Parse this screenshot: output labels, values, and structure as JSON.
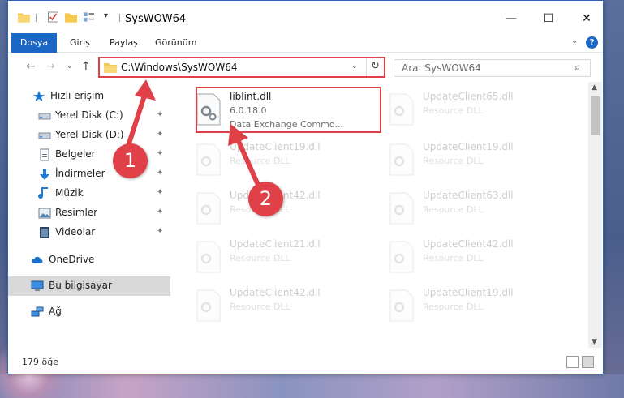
{
  "window": {
    "title": "SysWOW64",
    "min_glyph": "—",
    "max_glyph": "☐",
    "close_glyph": "✕"
  },
  "ribbon": {
    "tabs": [
      "Dosya",
      "Giriş",
      "Paylaş",
      "Görünüm"
    ],
    "help_glyph": "?"
  },
  "navigation": {
    "back_glyph": "←",
    "forward_glyph": "→",
    "history_glyph": "⌄",
    "up_glyph": "↑"
  },
  "address": {
    "path": "C:\\Windows\\SysWOW64",
    "refresh_glyph": "↻"
  },
  "search": {
    "placeholder": "Ara: SysWOW64",
    "icon_glyph": "⌕"
  },
  "sidebar": {
    "items": [
      {
        "label": "Hızlı erişim",
        "icon": "star-icon",
        "pinned": false
      },
      {
        "label": "Yerel Disk (C:)",
        "icon": "drive-icon",
        "pinned": true
      },
      {
        "label": "Yerel Disk (D:)",
        "icon": "drive-icon",
        "pinned": true
      },
      {
        "label": "Belgeler",
        "icon": "documents-icon",
        "pinned": true
      },
      {
        "label": "İndirmeler",
        "icon": "download-icon",
        "pinned": true
      },
      {
        "label": "Müzik",
        "icon": "music-icon",
        "pinned": true
      },
      {
        "label": "Resimler",
        "icon": "pictures-icon",
        "pinned": true
      },
      {
        "label": "Videolar",
        "icon": "videos-icon",
        "pinned": true
      },
      {
        "label": "OneDrive",
        "icon": "cloud-icon",
        "pinned": false
      },
      {
        "label": "Bu bilgisayar",
        "icon": "computer-icon",
        "pinned": false
      },
      {
        "label": "Ağ",
        "icon": "network-icon",
        "pinned": false
      }
    ],
    "pin_glyph": "📌"
  },
  "files": {
    "highlighted": {
      "name": "liblint.dll",
      "version": "6.0.18.0",
      "description": "Data Exchange Commo..."
    },
    "others": [
      {
        "name": "UpdateClient65.dll",
        "description": "Resource DLL"
      },
      {
        "name": "UpdateClient19.dll",
        "description": "Resource DLL"
      },
      {
        "name": "UpdateClient19.dll",
        "description": "Resource DLL"
      },
      {
        "name": "UpdateClient42.dll",
        "description": "Resource DLL"
      },
      {
        "name": "UpdateClient63.dll",
        "description": "Resource DLL"
      },
      {
        "name": "UpdateClient21.dll",
        "description": "Resource DLL"
      },
      {
        "name": "UpdateClient42.dll",
        "description": "Resource DLL"
      },
      {
        "name": "UpdateClient42.dll",
        "description": "Resource DLL"
      },
      {
        "name": "UpdateClient19.dll",
        "description": "Resource DLL"
      }
    ]
  },
  "scrollbar": {
    "up_glyph": "▲",
    "down_glyph": "▼"
  },
  "status": {
    "item_count": "179 öğe"
  },
  "callouts": {
    "step1": "1",
    "step2": "2"
  },
  "colors": {
    "accent": "#1a67c6",
    "annotation": "#e04048",
    "selection": "#cce8ff"
  }
}
